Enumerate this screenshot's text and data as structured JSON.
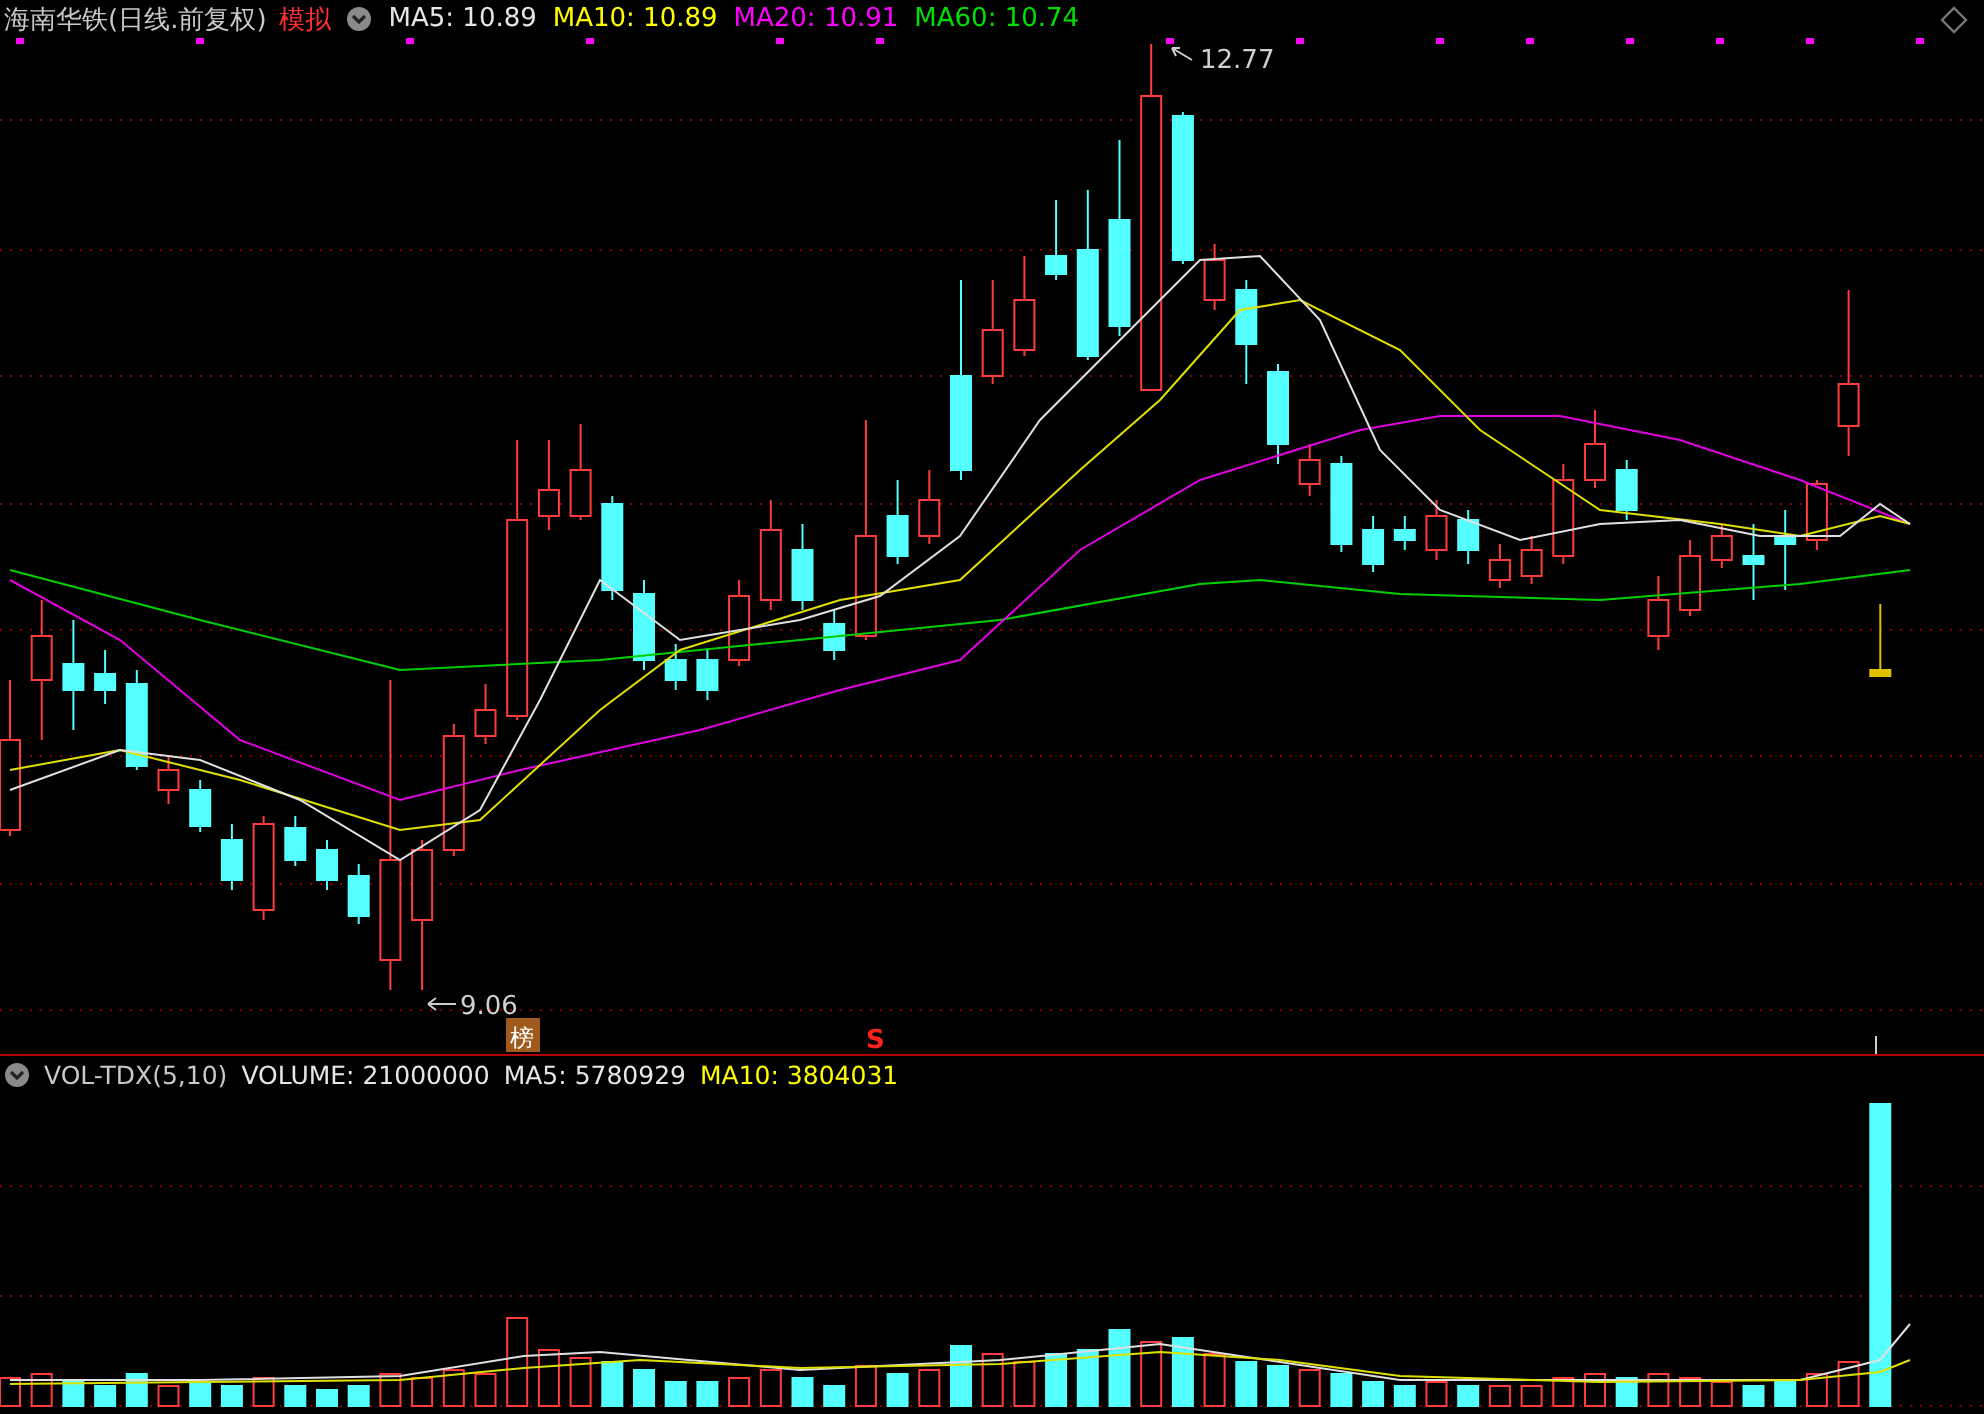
{
  "price_panel": {
    "title": "海南华铁(日线.前复权)",
    "mode_badge": "模拟",
    "indicators": [
      {
        "label": "MA5: 10.89",
        "color": "#e6e6e6"
      },
      {
        "label": "MA10: 10.89",
        "color": "#ffff00"
      },
      {
        "label": "MA20: 10.91",
        "color": "#ff00ff"
      },
      {
        "label": "MA60: 10.74",
        "color": "#00e000"
      }
    ],
    "high_label": "12.77",
    "low_label": "9.06",
    "markers": [
      {
        "kind": "badge",
        "text": "榜"
      },
      {
        "kind": "signal",
        "text": "S"
      }
    ]
  },
  "volume_panel": {
    "title": "VOL-TDX(5,10)",
    "indicators": [
      {
        "label": "VOLUME: 21000000",
        "color": "#e6e6e6"
      },
      {
        "label": "MA5: 5780929",
        "color": "#e6e6e6"
      },
      {
        "label": "MA10: 3804031",
        "color": "#ffff00"
      }
    ]
  }
}
